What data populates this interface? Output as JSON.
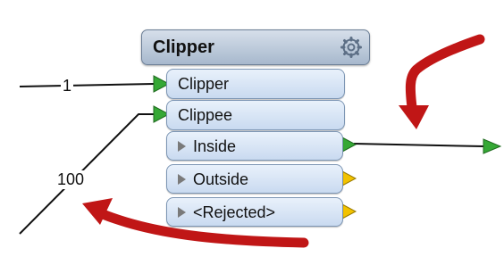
{
  "transformer": {
    "title": "Clipper",
    "inputs": [
      {
        "label": "Clipper"
      },
      {
        "label": "Clippee"
      }
    ],
    "outputs": [
      {
        "label": "Inside",
        "port_color": "#3cb043"
      },
      {
        "label": "Outside",
        "port_color": "#f2c200"
      },
      {
        "label": "<Rejected>",
        "port_color": "#f2c200"
      }
    ]
  },
  "connections": {
    "clipper_feature_count": "1",
    "clippee_feature_count": "100"
  },
  "colors": {
    "input_arrow": "#35a835",
    "annotation_arrow": "#c01616"
  }
}
